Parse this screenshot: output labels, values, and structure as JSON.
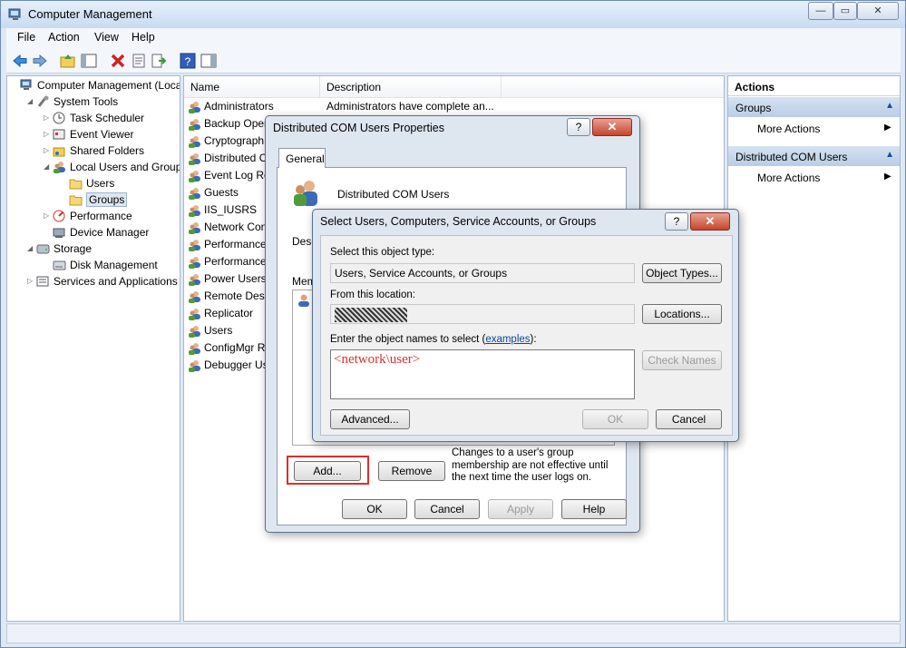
{
  "window": {
    "title": "Computer Management",
    "min": "—",
    "max": "▭",
    "close": "✕"
  },
  "menu": [
    "File",
    "Action",
    "View",
    "Help"
  ],
  "tree": [
    {
      "label": "Computer Management (Local",
      "indent": 0,
      "exp": "",
      "icon": "computer-icon"
    },
    {
      "label": "System Tools",
      "indent": 1,
      "exp": "◢",
      "icon": "tools-icon"
    },
    {
      "label": "Task Scheduler",
      "indent": 2,
      "exp": "▷",
      "icon": "clock-icon"
    },
    {
      "label": "Event Viewer",
      "indent": 2,
      "exp": "▷",
      "icon": "event-viewer-icon"
    },
    {
      "label": "Shared Folders",
      "indent": 2,
      "exp": "▷",
      "icon": "shared-folder-icon"
    },
    {
      "label": "Local Users and Groups",
      "indent": 2,
      "exp": "◢",
      "icon": "users-icon"
    },
    {
      "label": "Users",
      "indent": 3,
      "exp": "",
      "icon": "folder-icon"
    },
    {
      "label": "Groups",
      "indent": 3,
      "exp": "",
      "icon": "folder-icon"
    },
    {
      "label": "Performance",
      "indent": 2,
      "exp": "▷",
      "icon": "performance-icon"
    },
    {
      "label": "Device Manager",
      "indent": 2,
      "exp": "",
      "icon": "device-manager-icon"
    },
    {
      "label": "Storage",
      "indent": 1,
      "exp": "◢",
      "icon": "storage-icon"
    },
    {
      "label": "Disk Management",
      "indent": 2,
      "exp": "",
      "icon": "disk-icon"
    },
    {
      "label": "Services and Applications",
      "indent": 1,
      "exp": "▷",
      "icon": "services-icon"
    }
  ],
  "list": {
    "headers": [
      "Name",
      "Description"
    ],
    "rows": [
      {
        "name": "Administrators",
        "desc": "Administrators have complete an..."
      },
      {
        "name": "Backup Oper",
        "desc": ""
      },
      {
        "name": "Cryptograph",
        "desc": ""
      },
      {
        "name": "Distributed C",
        "desc": ""
      },
      {
        "name": "Event Log Re",
        "desc": ""
      },
      {
        "name": "Guests",
        "desc": ""
      },
      {
        "name": "IIS_IUSRS",
        "desc": ""
      },
      {
        "name": "Network Con",
        "desc": ""
      },
      {
        "name": "Performance",
        "desc": ""
      },
      {
        "name": "Performance",
        "desc": ""
      },
      {
        "name": "Power Users",
        "desc": ""
      },
      {
        "name": "Remote Desk",
        "desc": ""
      },
      {
        "name": "Replicator",
        "desc": ""
      },
      {
        "name": "Users",
        "desc": ""
      },
      {
        "name": "ConfigMgr R",
        "desc": ""
      },
      {
        "name": "Debugger Us",
        "desc": ""
      }
    ]
  },
  "actions": {
    "header": "Actions",
    "groups": [
      {
        "title": "Groups",
        "item": "More Actions"
      },
      {
        "title": "Distributed COM Users",
        "item": "More Actions"
      }
    ]
  },
  "props_dialog": {
    "title": "Distributed COM Users Properties",
    "help": "?",
    "tab": "General",
    "group_name": "Distributed COM Users",
    "desc_label": "Desc",
    "members_label": "Mem",
    "add": "Add...",
    "remove": "Remove",
    "note": "Changes to a user's group membership are not effective until the next time the user logs on.",
    "ok": "OK",
    "cancel": "Cancel",
    "apply": "Apply",
    "help_btn": "Help"
  },
  "select_dialog": {
    "title": "Select Users, Computers, Service Accounts, or Groups",
    "help": "?",
    "close": "✕",
    "object_type_label": "Select this object type:",
    "object_type_value": "Users, Service Accounts, or Groups",
    "object_types_btn": "Object Types...",
    "location_label": "From this location:",
    "locations_btn": "Locations...",
    "names_label_pre": "Enter the object names to select (",
    "names_link": "examples",
    "names_label_post": "):",
    "names_value": "<network\\user>",
    "check_names": "Check Names",
    "advanced": "Advanced...",
    "ok": "OK",
    "cancel": "Cancel"
  },
  "colors": {
    "highlight_red": "#d9302c",
    "link": "#0645ad"
  }
}
